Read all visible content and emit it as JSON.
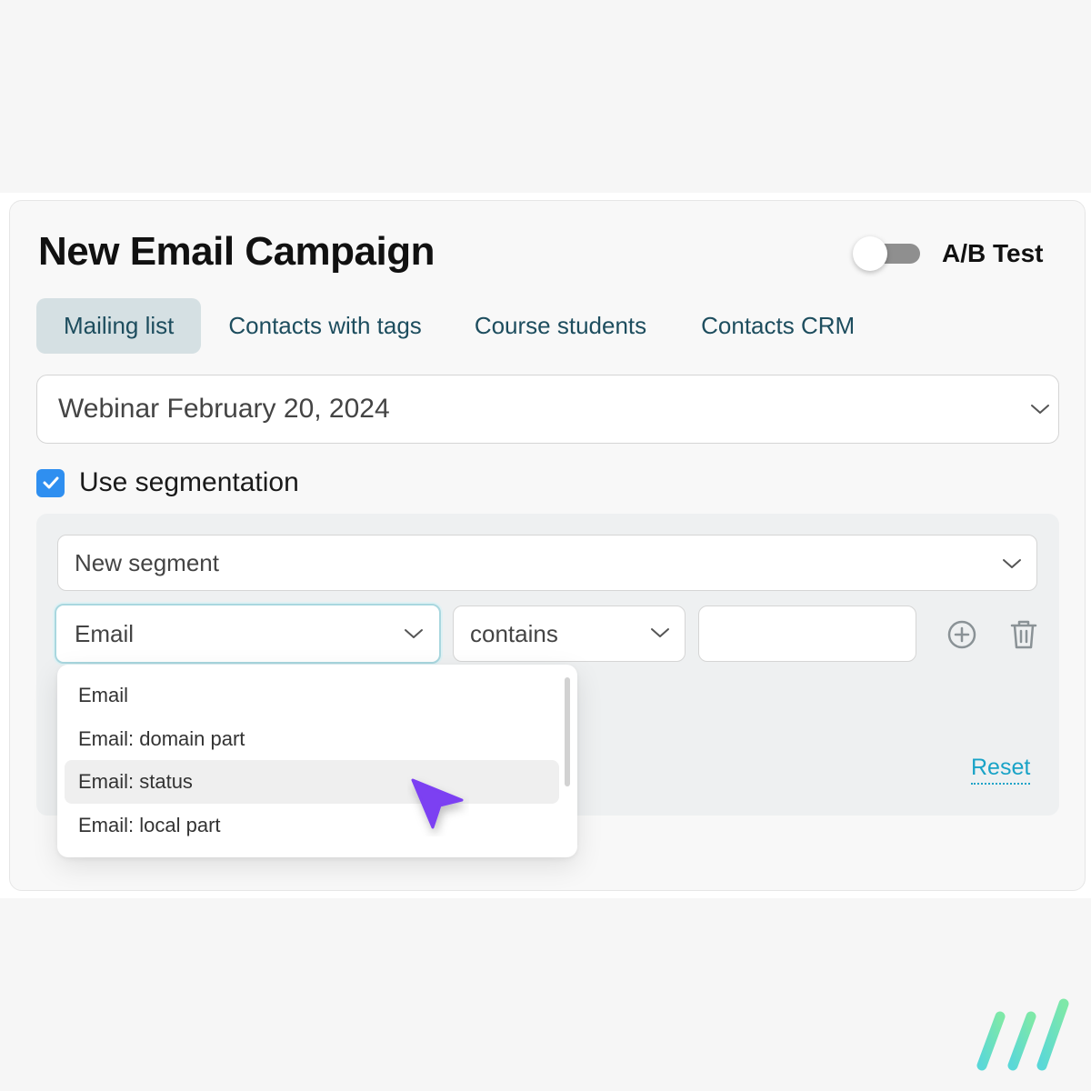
{
  "header": {
    "title": "New Email Campaign",
    "ab_test_label": "A/B Test",
    "ab_test_enabled": false
  },
  "tabs": [
    {
      "label": "Mailing list",
      "active": true
    },
    {
      "label": "Contacts with tags",
      "active": false
    },
    {
      "label": "Course students",
      "active": false
    },
    {
      "label": "Contacts CRM",
      "active": false
    }
  ],
  "mailing_list": {
    "selected": "Webinar February 20, 2024"
  },
  "segmentation": {
    "label": "Use segmentation",
    "checked": true,
    "segment_select": "New segment",
    "rule": {
      "field": "Email",
      "operator": "contains",
      "value": ""
    },
    "reset_label": "Reset"
  },
  "field_dropdown": {
    "options": [
      {
        "label": "Email",
        "hovered": false
      },
      {
        "label": "Email: domain part",
        "hovered": false
      },
      {
        "label": "Email: status",
        "hovered": true
      },
      {
        "label": "Email: local part",
        "hovered": false
      }
    ]
  },
  "colors": {
    "tab_text": "#1d4d5e",
    "tab_active_bg": "#d5e0e3",
    "checkbox": "#2f8ff0",
    "link": "#1aa3c7",
    "cursor": "#7b3ff2",
    "brand_gradient_start": "#5ad8d8",
    "brand_gradient_end": "#7ee8a8"
  },
  "icons": {
    "add_rule": "plus-circle-icon",
    "delete_rule": "trash-icon",
    "dropdown": "chevron-down-icon",
    "pointer": "cursor-arrow-icon",
    "brand": "triple-slash-logo-icon"
  }
}
